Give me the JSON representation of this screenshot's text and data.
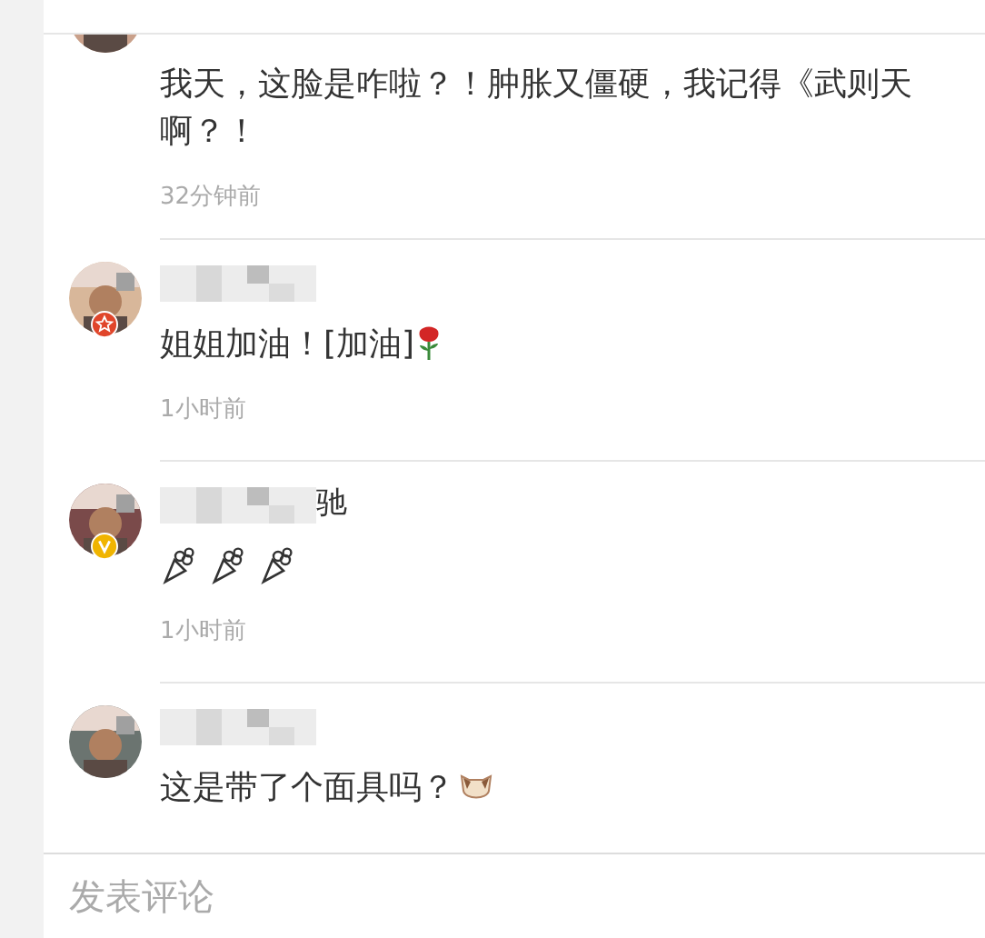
{
  "comments": [
    {
      "star_badge": false,
      "verified": false,
      "segments": [
        {
          "kind": "text",
          "text": "我天，这脸是咋啦？！肿胀又僵硬，我记得《武则天"
        }
      ],
      "segments_line2": [
        {
          "kind": "text",
          "text": "啊？！"
        }
      ],
      "time": "32分钟前"
    },
    {
      "star_badge": true,
      "verified": false,
      "name_blurred": true,
      "segments": [
        {
          "kind": "text",
          "text": "姐姐加油！[加油]"
        },
        {
          "kind": "rose"
        }
      ],
      "time": "1小时前"
    },
    {
      "star_badge": false,
      "verified": true,
      "name_blurred": true,
      "name_tail": "驰",
      "segments": [
        {
          "kind": "bouquet"
        },
        {
          "kind": "bouquet"
        },
        {
          "kind": "bouquet"
        }
      ],
      "time": "1小时前"
    },
    {
      "star_badge": false,
      "verified": false,
      "name_blurred": true,
      "segments": [
        {
          "kind": "text",
          "text": "这是带了个面具吗？"
        },
        {
          "kind": "cat"
        }
      ]
    }
  ],
  "comment_box": {
    "placeholder": "发表评论"
  }
}
